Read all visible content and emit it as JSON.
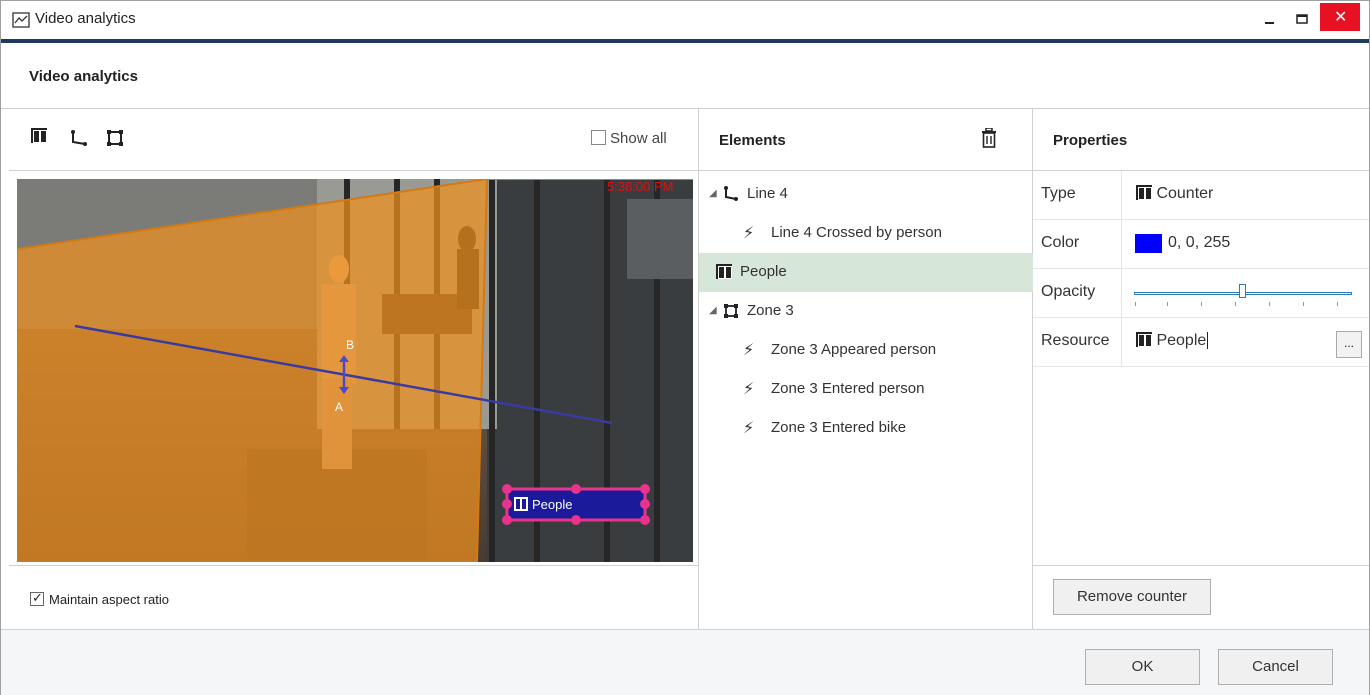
{
  "window": {
    "title": "Video analytics"
  },
  "header": {
    "title": "Video analytics"
  },
  "toolbar": {
    "show_all_label": "Show all"
  },
  "video": {
    "timestamp": "5:38:00 PM",
    "counter_label": "People",
    "line_a": "A",
    "line_b": "B"
  },
  "options": {
    "maintain_aspect_label": "Maintain aspect ratio"
  },
  "elements": {
    "title": "Elements",
    "items": [
      {
        "label": "Line 4"
      },
      {
        "label": "Line 4 Crossed by person"
      },
      {
        "label": "People"
      },
      {
        "label": "Zone 3"
      },
      {
        "label": "Zone 3 Appeared person"
      },
      {
        "label": "Zone 3 Entered person"
      },
      {
        "label": "Zone 3 Entered bike"
      }
    ]
  },
  "properties": {
    "title": "Properties",
    "rows": [
      {
        "key": "Type",
        "value": "Counter"
      },
      {
        "key": "Color",
        "value": "0, 0, 255",
        "color": "#0000ff"
      },
      {
        "key": "Opacity",
        "value": 0.52
      },
      {
        "key": "Resource",
        "value": "People",
        "button": "..."
      }
    ],
    "remove_label": "Remove counter"
  },
  "footer": {
    "ok_label": "OK",
    "cancel_label": "Cancel"
  },
  "colors": {
    "zone_fill": "#f0901e",
    "line": "#3a3aa0",
    "selection": "#d6e6d8",
    "close": "#e81123",
    "counter_box": "#1a1a9a",
    "counter_border": "#e8338a"
  }
}
